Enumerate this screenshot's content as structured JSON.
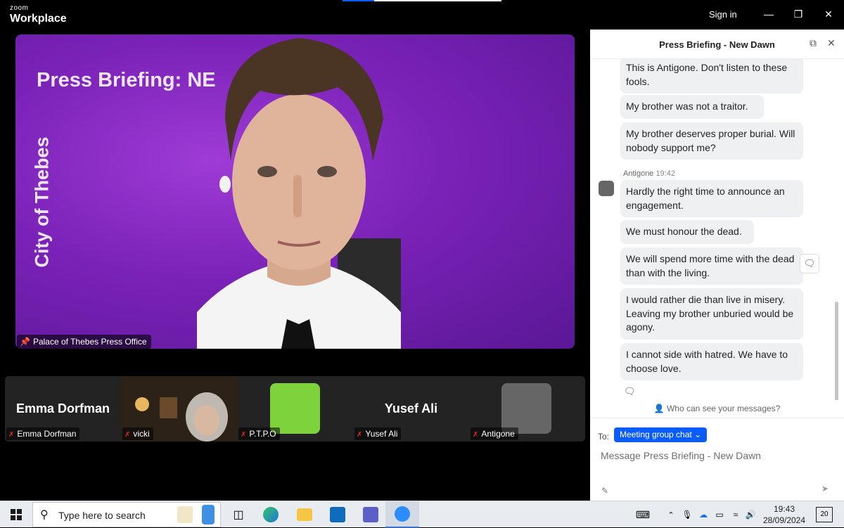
{
  "titlebar": {
    "brand_line1": "zoom",
    "brand_line2": "Workplace",
    "sign_in": "Sign in"
  },
  "stage": {
    "title": "Press Briefing: NE",
    "vertical_text": "City of Thebes",
    "speaker_name": "Palace of Thebes Press Office"
  },
  "participants": [
    {
      "display": "Emma Dorfman",
      "name": "Emma Dorfman",
      "muted": true
    },
    {
      "display": "",
      "name": "vicki",
      "muted": true
    },
    {
      "display": "",
      "name": "P.T.P.O",
      "muted": true,
      "avatar_color": "#7ed23b"
    },
    {
      "display": "Yusef Ali",
      "name": "Yusef Ali",
      "muted": true
    },
    {
      "display": "",
      "name": "Antigone",
      "muted": true,
      "avatar_color": "#666666"
    }
  ],
  "chat": {
    "title": "Press Briefing - New Dawn",
    "messages": [
      {
        "text": "This is Antigone. Don't listen to these fools."
      },
      {
        "text": "My brother was not a traitor."
      },
      {
        "text": "My brother deserves proper burial. Will nobody support me?"
      },
      {
        "sender": "Antigone",
        "time": "19:42",
        "text": "Hardly the right time to announce an engagement."
      },
      {
        "text": "We must honour the dead."
      },
      {
        "text": "We will spend more time with the dead than with the living."
      },
      {
        "text": "I would rather die than live in misery. Leaving my brother unburied would be agony."
      },
      {
        "text": "I cannot side with hatred. We have to choose love."
      }
    ],
    "who_can_see": "Who can see your messages?",
    "to_label": "To:",
    "to_value": "Meeting group chat",
    "input_placeholder": "Message Press Briefing - New Dawn"
  },
  "taskbar": {
    "search_placeholder": "Type here to search",
    "time": "19:43",
    "date": "28/09/2024",
    "notifications": "20"
  }
}
